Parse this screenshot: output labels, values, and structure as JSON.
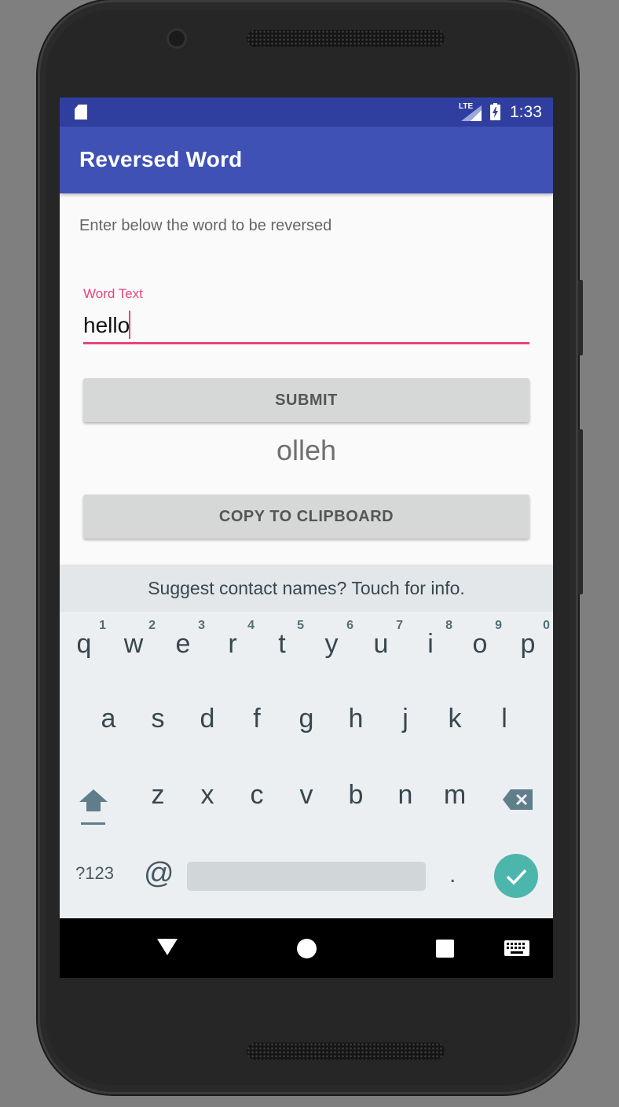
{
  "status_bar": {
    "network": "LTE",
    "time": "1:33"
  },
  "app_bar": {
    "title": "Reversed Word"
  },
  "main": {
    "instruction": "Enter below the word to be reversed",
    "word_input": {
      "label": "Word Text",
      "value": "hello"
    },
    "submit_label": "SUBMIT",
    "result": "olleh",
    "copy_label": "COPY TO CLIPBOARD"
  },
  "keyboard": {
    "suggestion": "Suggest contact names? Touch for info.",
    "row1": [
      {
        "ch": "q",
        "num": "1"
      },
      {
        "ch": "w",
        "num": "2"
      },
      {
        "ch": "e",
        "num": "3"
      },
      {
        "ch": "r",
        "num": "4"
      },
      {
        "ch": "t",
        "num": "5"
      },
      {
        "ch": "y",
        "num": "6"
      },
      {
        "ch": "u",
        "num": "7"
      },
      {
        "ch": "i",
        "num": "8"
      },
      {
        "ch": "o",
        "num": "9"
      },
      {
        "ch": "p",
        "num": "0"
      }
    ],
    "row2": [
      "a",
      "s",
      "d",
      "f",
      "g",
      "h",
      "j",
      "k",
      "l"
    ],
    "row3": [
      "z",
      "x",
      "c",
      "v",
      "b",
      "n",
      "m"
    ],
    "symbols_label": "?123",
    "at_label": "@",
    "period_label": ".",
    "icons": {
      "shift": "shift-icon",
      "backspace": "backspace-icon",
      "enter": "check-icon"
    }
  },
  "navigation": {
    "icons": [
      "back-icon",
      "home-icon",
      "recent-apps-icon",
      "keyboard-icon"
    ]
  },
  "colors": {
    "primary": "#3f51b5",
    "primary_dark": "#303f9f",
    "accent": "#e8437f",
    "enter_key": "#4db6ac"
  }
}
